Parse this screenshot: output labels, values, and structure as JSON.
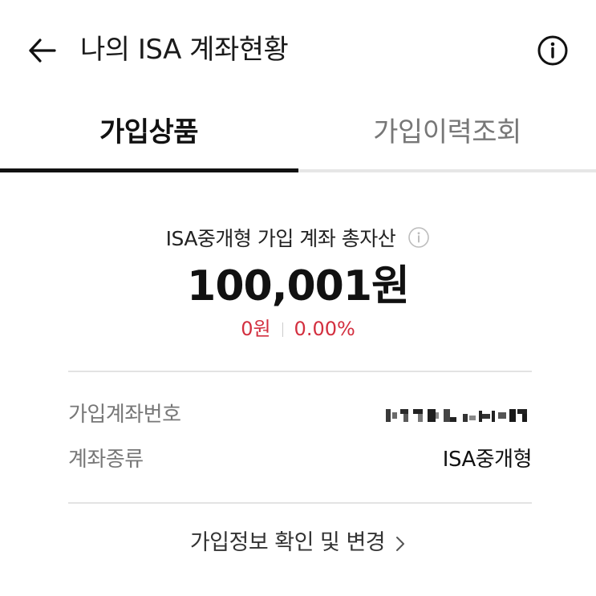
{
  "header": {
    "title": "나의 ISA 계좌현황"
  },
  "tabs": [
    {
      "label": "가입상품",
      "active": true
    },
    {
      "label": "가입이력조회",
      "active": false
    }
  ],
  "summary": {
    "label": "ISA중개형 가입 계좌 총자산",
    "total_amount": "100,001원",
    "change_amount": "0원",
    "change_rate": "0.00%"
  },
  "details": [
    {
      "key": "가입계좌번호",
      "value": "",
      "masked": true
    },
    {
      "key": "계좌종류",
      "value": "ISA중개형",
      "masked": false
    }
  ],
  "footer": {
    "link_label": "가입정보 확인 및 변경"
  },
  "colors": {
    "accent_red": "#d32f3f",
    "text_primary": "#111111",
    "text_secondary": "#777777"
  },
  "icons": {
    "back": "arrow-left-icon",
    "info": "info-circle-icon",
    "chevron": "chevron-right-icon"
  }
}
